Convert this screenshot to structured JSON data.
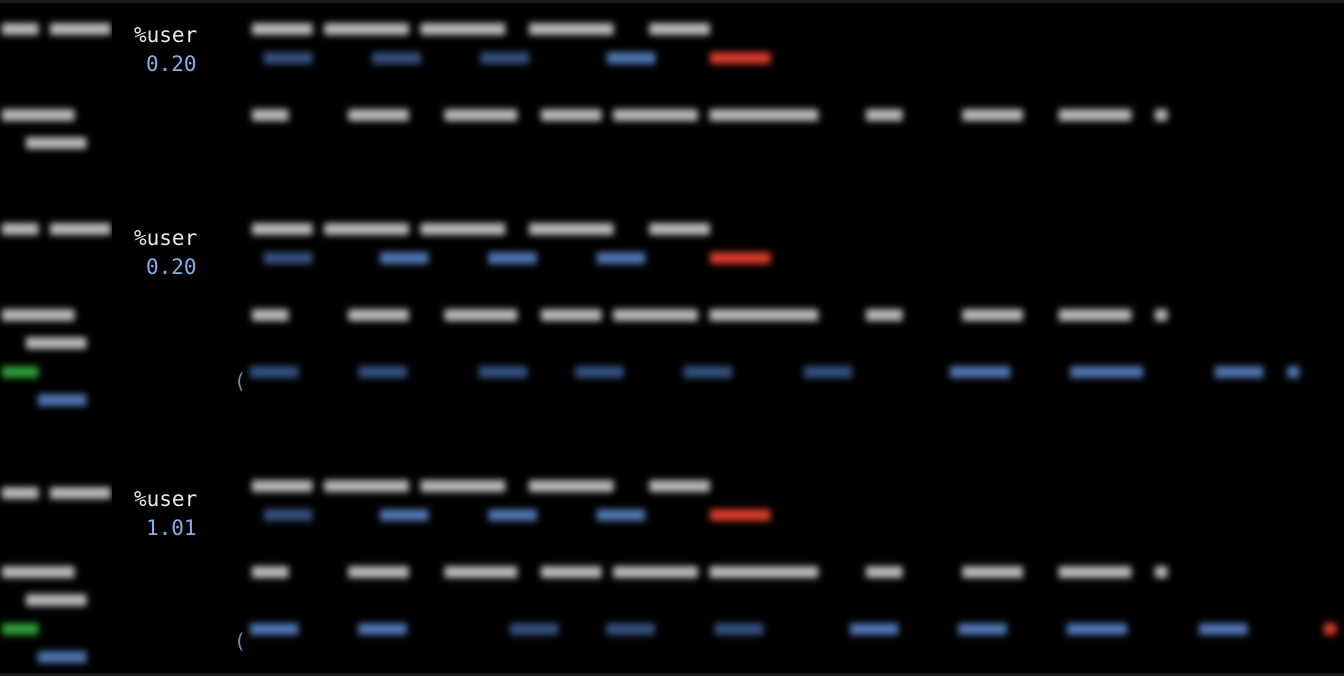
{
  "blocks": [
    {
      "header": "%user",
      "value": "0.20"
    },
    {
      "header": "%user",
      "value": "0.20"
    },
    {
      "header": "%user",
      "value": "1.01"
    }
  ],
  "colors": {
    "background": "#000000",
    "header_text": "#e8e8e8",
    "value_text": "#86aee6",
    "idle_highlight": "#d63a2a",
    "device_label": "#2e9b34"
  }
}
